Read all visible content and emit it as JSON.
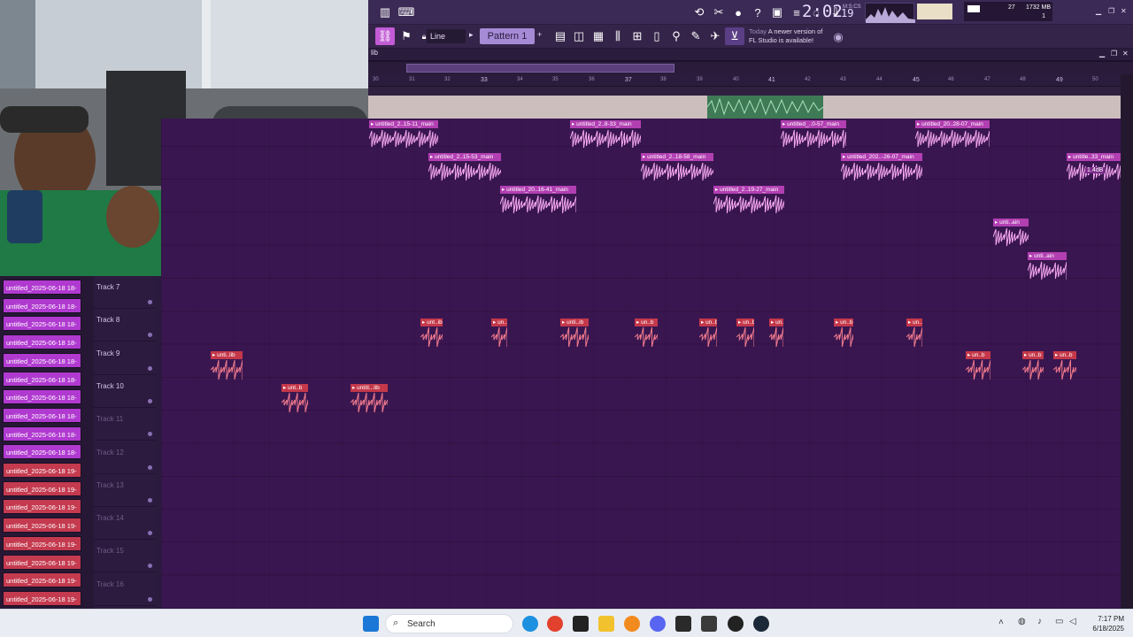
{
  "toolbar": {
    "time": "2:02",
    "time_frac": "19",
    "time_unit": "M:S:CS",
    "cpu_value": "27",
    "memory": "1732 MB",
    "voices": "1",
    "mode": "Line",
    "pattern": "Pattern 1",
    "hint_today": "Today",
    "hint_text1": "A newer version of",
    "hint_text2": "FL Studio is available!"
  },
  "playlist": {
    "header": "lib",
    "ruler": [
      "30",
      "31",
      "32",
      "33",
      "34",
      "35",
      "36",
      "37",
      "38",
      "39",
      "40",
      "41",
      "42",
      "43",
      "44",
      "45",
      "46",
      "47",
      "48",
      "49",
      "50"
    ]
  },
  "tracks": [
    {
      "label": "Track 7",
      "muted": false
    },
    {
      "label": "Track 8",
      "muted": false
    },
    {
      "label": "Track 9",
      "muted": false
    },
    {
      "label": "Track 10",
      "muted": false
    },
    {
      "label": "Track 11",
      "muted": true
    },
    {
      "label": "Track 12",
      "muted": true
    },
    {
      "label": "Track 13",
      "muted": true
    },
    {
      "label": "Track 14",
      "muted": true
    },
    {
      "label": "Track 15",
      "muted": true
    },
    {
      "label": "Track 16",
      "muted": true
    }
  ],
  "clips_pink": [
    {
      "label": "untitled_2..15-11_main"
    },
    {
      "label": "untitled_2..8-33_main"
    },
    {
      "label": "untitled_..0-57_main"
    },
    {
      "label": "untitled_20..28-07_main"
    },
    {
      "label": "untitled_2..15-53_main"
    },
    {
      "label": "untitled_2..18-58_main"
    },
    {
      "label": "untitled_202..-26-07_main"
    },
    {
      "label": "untitle..33_main"
    },
    {
      "label": "untitled_20..16-41_main"
    },
    {
      "label": "untitled_2..19-27_main"
    },
    {
      "label": "unti..ain"
    },
    {
      "label": "unti..ain"
    }
  ],
  "gain_label": "1.4dB",
  "clips_red": [
    {
      "label": "unt..ib"
    },
    {
      "label": "un..b"
    },
    {
      "label": "unti..ib"
    },
    {
      "label": "un..b"
    },
    {
      "label": "un..b"
    },
    {
      "label": "un..b"
    },
    {
      "label": "un..b"
    },
    {
      "label": "un..b"
    },
    {
      "label": "un..b"
    },
    {
      "label": "unti..lib"
    },
    {
      "label": "un..b"
    },
    {
      "label": "un..b"
    },
    {
      "label": "un..b"
    },
    {
      "label": "unt..b"
    },
    {
      "label": "untitl...lib"
    }
  ],
  "sidebar": [
    {
      "label": "untitled_2025-06-18 18-",
      "color": "pink"
    },
    {
      "label": "untitled_2025-06-18 18-",
      "color": "pink"
    },
    {
      "label": "untitled_2025-06-18 18-",
      "color": "pink"
    },
    {
      "label": "untitled_2025-06-18 18-",
      "color": "pink"
    },
    {
      "label": "untitled_2025-06-18 18-",
      "color": "pink"
    },
    {
      "label": "untitled_2025-06-18 18-",
      "color": "pink"
    },
    {
      "label": "untitled_2025-06-18 18-",
      "color": "pink"
    },
    {
      "label": "untitled_2025-06-18 18-",
      "color": "pink"
    },
    {
      "label": "untitled_2025-06-18 18-",
      "color": "pink"
    },
    {
      "label": "untitled_2025-06-18 18-",
      "color": "pink"
    },
    {
      "label": "untitled_2025-06-18 19-",
      "color": "red"
    },
    {
      "label": "untitled_2025-06-18 19-",
      "color": "red"
    },
    {
      "label": "untitled_2025-06-18 19-",
      "color": "red"
    },
    {
      "label": "untitled_2025-06-18 19-",
      "color": "red"
    },
    {
      "label": "untitled_2025-06-18 19-",
      "color": "red"
    },
    {
      "label": "untitled_2025-06-18 19-",
      "color": "red"
    },
    {
      "label": "untitled_2025-06-18 19-",
      "color": "red"
    },
    {
      "label": "untitled_2025-06-18 19-",
      "color": "red"
    }
  ],
  "taskbar": {
    "search": "Search",
    "time": "7:17 PM",
    "date": "6/18/2025"
  },
  "colors": {
    "accent": "#b03ad0",
    "red": "#c43a4f",
    "bg": "#3a1650"
  }
}
